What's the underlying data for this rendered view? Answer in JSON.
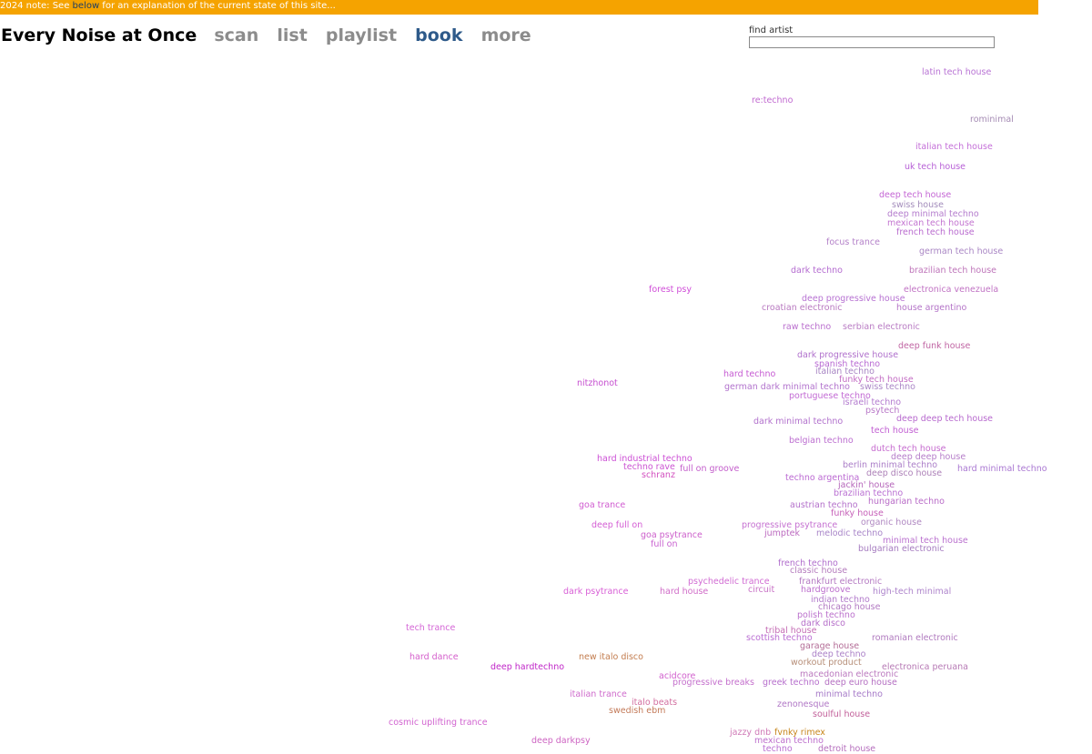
{
  "notice": {
    "prefix": "2024 note: See ",
    "link": "below",
    "suffix": " for an explanation of the current state of this site..."
  },
  "nav": {
    "title": "Every Noise at Once",
    "items": [
      "scan",
      "list",
      "playlist",
      "book",
      "more"
    ],
    "active": "book"
  },
  "search": {
    "label": "find artist",
    "value": ""
  },
  "genres": [
    {
      "name": "latin tech house",
      "color": "#b873d4"
    },
    {
      "name": "re:techno",
      "color": "#c069d0"
    },
    {
      "name": "rominimal",
      "color": "#a58bb4"
    },
    {
      "name": "italian tech house",
      "color": "#c46fd8"
    },
    {
      "name": "uk tech house",
      "color": "#b75fd6"
    },
    {
      "name": "deep tech house",
      "color": "#c466d4"
    },
    {
      "name": "swiss house",
      "color": "#a38cbb"
    },
    {
      "name": "deep minimal techno",
      "color": "#b47ccd"
    },
    {
      "name": "mexican tech house",
      "color": "#c374d0"
    },
    {
      "name": "french tech house",
      "color": "#b96bcf"
    },
    {
      "name": "focus trance",
      "color": "#b380c8"
    },
    {
      "name": "german tech house",
      "color": "#a986c4"
    },
    {
      "name": "dark techno",
      "color": "#b46bd0"
    },
    {
      "name": "brazilian tech house",
      "color": "#be74b9"
    },
    {
      "name": "forest psy",
      "color": "#d04ed8"
    },
    {
      "name": "electronica venezuela",
      "color": "#c173c4"
    },
    {
      "name": "deep progressive house",
      "color": "#b772d2"
    },
    {
      "name": "croatian electronic",
      "color": "#b879c0"
    },
    {
      "name": "house argentino",
      "color": "#b474c8"
    },
    {
      "name": "raw techno",
      "color": "#ba6fce"
    },
    {
      "name": "serbian electronic",
      "color": "#b97cc4"
    },
    {
      "name": "deep funk house",
      "color": "#c065a3"
    },
    {
      "name": "dark progressive house",
      "color": "#b070cc"
    },
    {
      "name": "spanish techno",
      "color": "#b869d3"
    },
    {
      "name": "italian techno",
      "color": "#a784c3"
    },
    {
      "name": "hard techno",
      "color": "#c55ad2"
    },
    {
      "name": "funky tech house",
      "color": "#c36dc4"
    },
    {
      "name": "nitzhonot",
      "color": "#c64fd0"
    },
    {
      "name": "german dark minimal techno",
      "color": "#b273cd"
    },
    {
      "name": "swiss techno",
      "color": "#aa86c6"
    },
    {
      "name": "portuguese techno",
      "color": "#c26ad4"
    },
    {
      "name": "israeli techno",
      "color": "#b37bcf"
    },
    {
      "name": "psytech",
      "color": "#b878c8"
    },
    {
      "name": "deep deep tech house",
      "color": "#b769ce"
    },
    {
      "name": "dark minimal techno",
      "color": "#b170cc"
    },
    {
      "name": "tech house",
      "color": "#c15ed2"
    },
    {
      "name": "belgian techno",
      "color": "#bc6ed0"
    },
    {
      "name": "dutch tech house",
      "color": "#c66ccf"
    },
    {
      "name": "deep deep house",
      "color": "#b57dc9"
    },
    {
      "name": "hard industrial techno",
      "color": "#cc4fd5"
    },
    {
      "name": "berlin minimal techno",
      "color": "#ab7ec8"
    },
    {
      "name": "techno rave",
      "color": "#cb53d2"
    },
    {
      "name": "full on groove",
      "color": "#c35ecb"
    },
    {
      "name": "hard minimal techno",
      "color": "#aa78d2"
    },
    {
      "name": "schranz",
      "color": "#d24fbf"
    },
    {
      "name": "deep disco house",
      "color": "#ad81b8"
    },
    {
      "name": "techno argentina",
      "color": "#bb69d2"
    },
    {
      "name": "jackin' house",
      "color": "#b565ba"
    },
    {
      "name": "brazilian techno",
      "color": "#b96fd2"
    },
    {
      "name": "hungarian techno",
      "color": "#b86bc7"
    },
    {
      "name": "goa trance",
      "color": "#d05bd0"
    },
    {
      "name": "austrian techno",
      "color": "#b471cb"
    },
    {
      "name": "funky house",
      "color": "#c660b8"
    },
    {
      "name": "deep full on",
      "color": "#d45ed4"
    },
    {
      "name": "progressive psytrance",
      "color": "#c571d1"
    },
    {
      "name": "organic house",
      "color": "#af87c1"
    },
    {
      "name": "goa psytrance",
      "color": "#cc5ecb"
    },
    {
      "name": "jumptek",
      "color": "#bb69bf"
    },
    {
      "name": "melodic techno",
      "color": "#a885c8"
    },
    {
      "name": "full on",
      "color": "#c962d0"
    },
    {
      "name": "minimal tech house",
      "color": "#ba71cf"
    },
    {
      "name": "bulgarian electronic",
      "color": "#a67cc0"
    },
    {
      "name": "french techno",
      "color": "#b06dcc"
    },
    {
      "name": "classic house",
      "color": "#b57cbe"
    },
    {
      "name": "psychedelic trance",
      "color": "#d16bd3"
    },
    {
      "name": "frankfurt electronic",
      "color": "#b479c2"
    },
    {
      "name": "dark psytrance",
      "color": "#d85fd6"
    },
    {
      "name": "hard house",
      "color": "#d06cc8"
    },
    {
      "name": "circuit",
      "color": "#c871c6"
    },
    {
      "name": "hardgroove",
      "color": "#bc6ecd"
    },
    {
      "name": "high-tech minimal",
      "color": "#ad83cb"
    },
    {
      "name": "indian techno",
      "color": "#b27acb"
    },
    {
      "name": "chicago house",
      "color": "#b279c2"
    },
    {
      "name": "polish techno",
      "color": "#bb70cc"
    },
    {
      "name": "tech trance",
      "color": "#d465d6"
    },
    {
      "name": "dark disco",
      "color": "#b56ec9"
    },
    {
      "name": "tribal house",
      "color": "#c46cb4"
    },
    {
      "name": "scottish techno",
      "color": "#b96cd2"
    },
    {
      "name": "romanian electronic",
      "color": "#b07abf"
    },
    {
      "name": "garage house",
      "color": "#b36c96"
    },
    {
      "name": "deep techno",
      "color": "#ab80c7"
    },
    {
      "name": "hard dance",
      "color": "#d45ecb"
    },
    {
      "name": "new italo disco",
      "color": "#c37d4f"
    },
    {
      "name": "workout product",
      "color": "#b68e78"
    },
    {
      "name": "deep hardtechno",
      "color": "#c026c8"
    },
    {
      "name": "electronica peruana",
      "color": "#b77ab5"
    },
    {
      "name": "macedonian electronic",
      "color": "#bb79bf"
    },
    {
      "name": "acidcore",
      "color": "#d15fcd"
    },
    {
      "name": "progressive breaks",
      "color": "#c46fcc"
    },
    {
      "name": "greek techno",
      "color": "#b66ecc"
    },
    {
      "name": "deep euro house",
      "color": "#b46fc2"
    },
    {
      "name": "italian trance",
      "color": "#cf6bcc"
    },
    {
      "name": "minimal techno",
      "color": "#a67ac8"
    },
    {
      "name": "italo beats",
      "color": "#d26e9f"
    },
    {
      "name": "zenonesque",
      "color": "#b178c6"
    },
    {
      "name": "swedish ebm",
      "color": "#c37a59"
    },
    {
      "name": "soulful house",
      "color": "#c2609a"
    },
    {
      "name": "cosmic uplifting trance",
      "color": "#d163d0"
    },
    {
      "name": "jazzy dnb",
      "color": "#cf79b6"
    },
    {
      "name": "fvnky rimex",
      "color": "#c7851b"
    },
    {
      "name": "deep darkpsy",
      "color": "#cd64c2"
    },
    {
      "name": "mexican techno",
      "color": "#bd6fcc"
    },
    {
      "name": "techno",
      "color": "#b96ed2"
    },
    {
      "name": "detroit house",
      "color": "#b56ebd"
    }
  ]
}
